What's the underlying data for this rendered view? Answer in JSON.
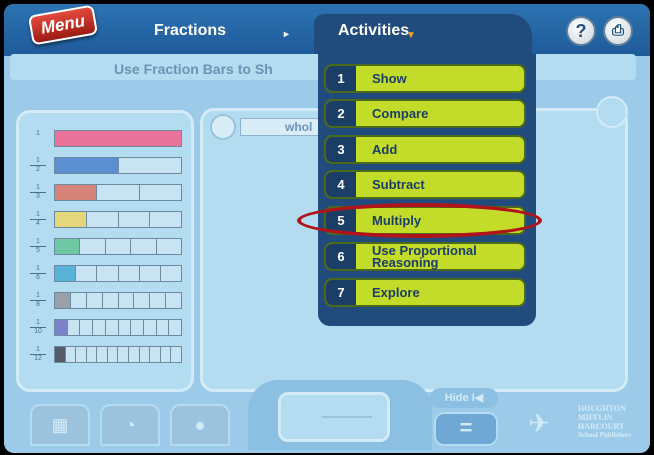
{
  "header": {
    "menu_label": "Menu",
    "nav_fractions": "Fractions",
    "nav_arrow": "►",
    "activities_label": "Activities",
    "activities_caret": "▼",
    "help_label": "?",
    "print_label": "⎙"
  },
  "instruction": "Use Fraction Bars to Sh",
  "fraction_bars": [
    {
      "numerator": "1",
      "denominator": "",
      "divisions": 1,
      "color": "#e9739a"
    },
    {
      "numerator": "1",
      "denominator": "2",
      "divisions": 2,
      "color": "#5a8fd1"
    },
    {
      "numerator": "1",
      "denominator": "3",
      "divisions": 3,
      "color": "#d6847a"
    },
    {
      "numerator": "1",
      "denominator": "4",
      "divisions": 4,
      "color": "#e3d77c"
    },
    {
      "numerator": "1",
      "denominator": "5",
      "divisions": 5,
      "color": "#6ec8a4"
    },
    {
      "numerator": "1",
      "denominator": "6",
      "divisions": 6,
      "color": "#5ab4d8"
    },
    {
      "numerator": "1",
      "denominator": "8",
      "divisions": 8,
      "color": "#9aa0a8"
    },
    {
      "numerator": "1",
      "denominator": "10",
      "divisions": 10,
      "color": "#7b82c8"
    },
    {
      "numerator": "1",
      "denominator": "12",
      "divisions": 12,
      "color": "#555c66"
    }
  ],
  "workspace": {
    "whole_label": "whol"
  },
  "activities_menu": [
    {
      "number": "1",
      "label": "Show"
    },
    {
      "number": "2",
      "label": "Compare"
    },
    {
      "number": "3",
      "label": "Add"
    },
    {
      "number": "4",
      "label": "Subtract"
    },
    {
      "number": "5",
      "label": "Multiply",
      "highlighted": true
    },
    {
      "number": "6",
      "label": "Use Proportional Reasoning"
    },
    {
      "number": "7",
      "label": "Explore"
    }
  ],
  "bottom": {
    "hide_label": "Hide",
    "hide_icon": "I◀",
    "equals_label": "=",
    "publisher_lines": [
      "HOUGHTON",
      "MIFFLIN",
      "HARCOURT",
      "School Publishers"
    ]
  }
}
